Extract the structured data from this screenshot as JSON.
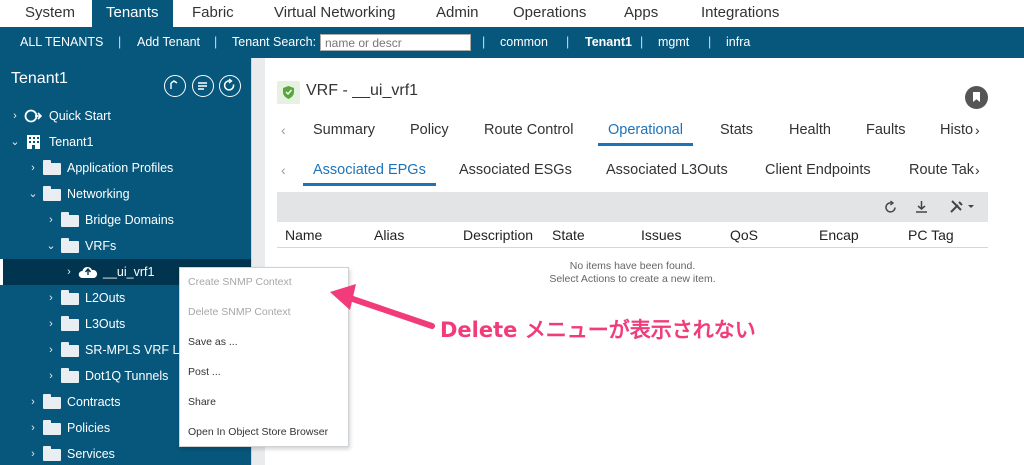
{
  "top_menu": {
    "items": [
      "System",
      "Tenants",
      "Fabric",
      "Virtual Networking",
      "Admin",
      "Operations",
      "Apps",
      "Integrations"
    ],
    "active": "Tenants"
  },
  "subbar": {
    "all_tenants": "ALL TENANTS",
    "add_tenant": "Add Tenant",
    "search_label": "Tenant Search:",
    "search_placeholder": "name or descr",
    "tenants": [
      "common",
      "Tenant1",
      "mgmt",
      "infra"
    ],
    "separator": "|"
  },
  "sidebar": {
    "title": "Tenant1",
    "tree": [
      {
        "label": "Quick Start",
        "chev": "›",
        "icon": "quick-start-icon"
      },
      {
        "label": "Tenant1",
        "chev": "⌄",
        "icon": "tenant-building-icon"
      },
      {
        "label": "Application Profiles",
        "chev": "›",
        "icon": "folder-icon"
      },
      {
        "label": "Networking",
        "chev": "⌄",
        "icon": "folder-icon"
      },
      {
        "label": "Bridge Domains",
        "chev": "›",
        "icon": "folder-icon"
      },
      {
        "label": "VRFs",
        "chev": "⌄",
        "icon": "folder-icon"
      },
      {
        "label": "__ui_vrf1",
        "chev": "›",
        "icon": "vrf-cloud-icon"
      },
      {
        "label": "L2Outs",
        "chev": "›",
        "icon": "folder-icon"
      },
      {
        "label": "L3Outs",
        "chev": "›",
        "icon": "folder-icon"
      },
      {
        "label": "SR-MPLS VRF L3",
        "chev": "›",
        "icon": "folder-icon"
      },
      {
        "label": "Dot1Q Tunnels",
        "chev": "›",
        "icon": "folder-icon"
      },
      {
        "label": "Contracts",
        "chev": "›",
        "icon": "folder-icon"
      },
      {
        "label": "Policies",
        "chev": "›",
        "icon": "folder-icon"
      },
      {
        "label": "Services",
        "chev": "›",
        "icon": "folder-icon"
      }
    ]
  },
  "main": {
    "title": "VRF - __ui_vrf1",
    "tabs": [
      "Summary",
      "Policy",
      "Route Control",
      "Operational",
      "Stats",
      "Health",
      "Faults",
      "Histo"
    ],
    "active_tab": "Operational",
    "subtabs": [
      "Associated EPGs",
      "Associated ESGs",
      "Associated L3Outs",
      "Client Endpoints",
      "Route Tak"
    ],
    "active_subtab": "Associated EPGs",
    "columns": [
      "Name",
      "Alias",
      "Description",
      "State",
      "Issues",
      "QoS",
      "Encap",
      "PC Tag"
    ],
    "empty_line1": "No items have been found.",
    "empty_line2": "Select Actions to create a new item."
  },
  "context_menu": {
    "items": [
      {
        "label": "Create SNMP Context",
        "disabled": true
      },
      {
        "label": "Delete SNMP Context",
        "disabled": true
      },
      {
        "label": "Save as ...",
        "disabled": false
      },
      {
        "label": "Post ...",
        "disabled": false
      },
      {
        "label": "Share",
        "disabled": false
      },
      {
        "label": "Open In Object Store Browser",
        "disabled": false
      }
    ]
  },
  "annotation": {
    "text": "Delete メニューが表示されない",
    "color": "#f13b7a"
  },
  "colors": {
    "nav_blue": "#07567c",
    "accent_blue": "#1d73b9",
    "annotation_pink": "#f13b7a"
  }
}
